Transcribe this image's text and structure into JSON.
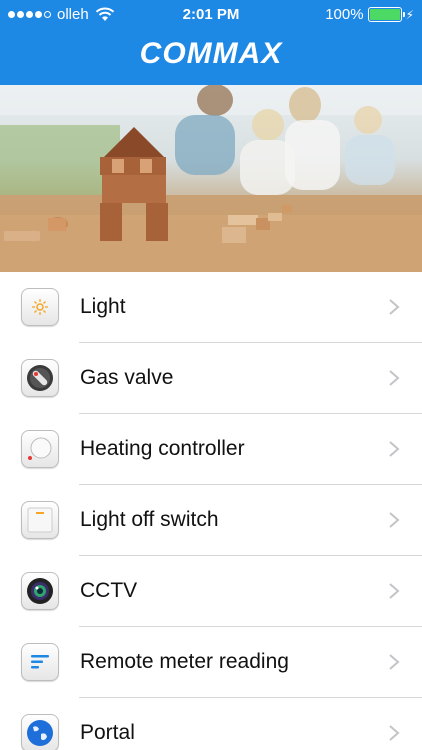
{
  "status_bar": {
    "carrier": "olleh",
    "time": "2:01 PM",
    "battery": "100%"
  },
  "header": {
    "logo": "COMMAX",
    "background": "#1e88e5"
  },
  "menu": {
    "items": [
      {
        "label": "Light",
        "icon": "light-icon"
      },
      {
        "label": "Gas valve",
        "icon": "gas-valve-icon"
      },
      {
        "label": "Heating controller",
        "icon": "thermostat-icon"
      },
      {
        "label": "Light off switch",
        "icon": "switch-icon"
      },
      {
        "label": "CCTV",
        "icon": "camera-icon"
      },
      {
        "label": "Remote meter reading",
        "icon": "meter-icon"
      },
      {
        "label": "Portal",
        "icon": "globe-icon"
      }
    ]
  }
}
